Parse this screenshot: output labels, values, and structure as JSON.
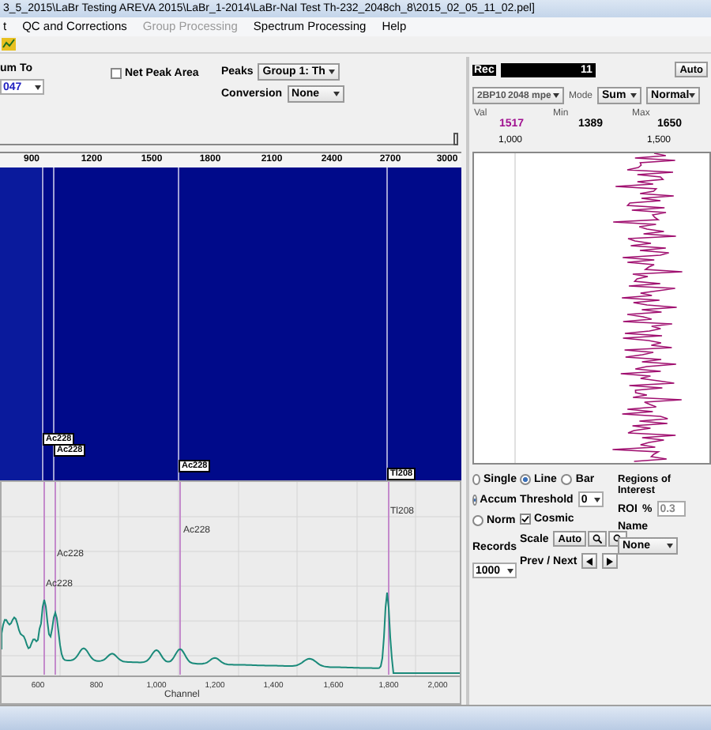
{
  "window": {
    "title": "3_5_2015\\LaBr Testing AREVA 2015\\LaBr_1-2014\\LaBr-NaI Test Th-232_2048ch_8\\2015_02_05_11_02.pel]"
  },
  "menu": [
    {
      "label": "t",
      "disabled": false
    },
    {
      "label": "QC and Corrections",
      "disabled": false
    },
    {
      "label": "Group Processing",
      "disabled": true
    },
    {
      "label": "Spectrum Processing",
      "disabled": false
    },
    {
      "label": "Help",
      "disabled": false
    }
  ],
  "controls": {
    "sum_to_label": "um To",
    "sum_to_value": "047",
    "net_peak_area": {
      "label": "Net Peak Area",
      "checked": false
    },
    "peaks_label": "Peaks",
    "peaks_value": "Group 1: Th",
    "conversion_label": "Conversion",
    "conversion_value": "None"
  },
  "waterfall": {
    "axis_ticks": [
      "900",
      "1200",
      "1500",
      "1800",
      "2100",
      "2400",
      "2700",
      "3000"
    ],
    "markers": [
      "Ac228",
      "Ac228",
      "Ac228",
      "Tl208"
    ]
  },
  "spectrum": {
    "markers": [
      "Ac228",
      "Ac228",
      "Ac228",
      "Tl208"
    ],
    "xticks": [
      "600",
      "800",
      "1,000",
      "1,200",
      "1,400",
      "1,600",
      "1,800",
      "2,000"
    ],
    "xlabel": "Channel"
  },
  "record": {
    "label": "Rec",
    "value": "11",
    "auto_button": "Auto",
    "detector": "2BP10",
    "channels": "2048 mpe",
    "mode_label": "Mode",
    "mode_value": "Sum",
    "scale_value": "Normal",
    "stats": [
      {
        "label": "Val",
        "value": "1517"
      },
      {
        "label": "Min",
        "value": "1389"
      },
      {
        "label": "Max",
        "value": "1650"
      }
    ],
    "axis_ticks": [
      "1,000",
      "1,500"
    ]
  },
  "display": {
    "accumulation": [
      {
        "label": "Single",
        "selected": false
      },
      {
        "label": "Accum",
        "selected": true
      },
      {
        "label": "Norm",
        "selected": false
      }
    ],
    "style": [
      {
        "label": "Line",
        "selected": true
      },
      {
        "label": "Bar",
        "selected": false
      }
    ],
    "threshold_label": "Threshold",
    "threshold_value": "0",
    "cosmic": {
      "label": "Cosmic",
      "checked": true
    },
    "scale_label": "Scale",
    "scale_auto": "Auto",
    "records_label": "Records",
    "records_value": "1000",
    "prev_next_label": "Prev / Next"
  },
  "roi": {
    "title": "Regions of Interest",
    "roi_label": "ROI",
    "percent": "%",
    "roi_value": "0.3",
    "name_label": "Name",
    "name_value": "None"
  }
}
